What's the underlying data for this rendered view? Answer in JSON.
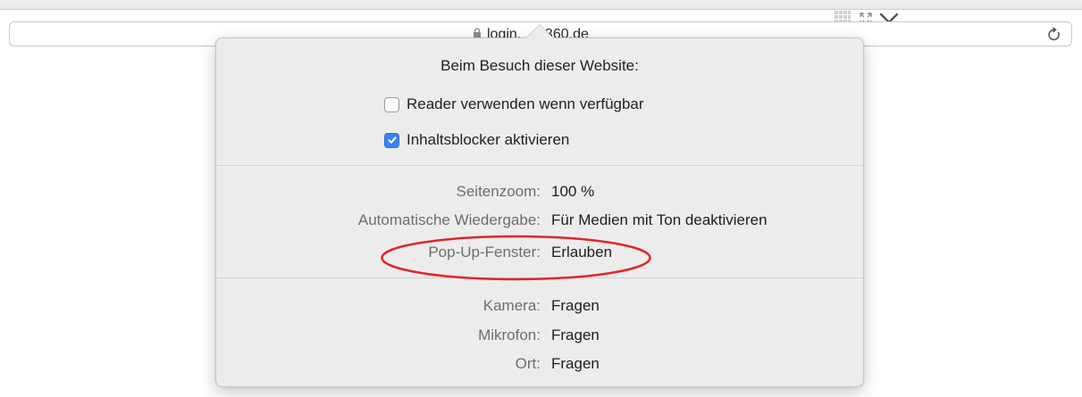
{
  "browser": {
    "url": "login.    a360.de",
    "reload_icon": "reload-icon",
    "lock_icon": "lock-icon"
  },
  "popover": {
    "heading": "Beim Besuch dieser Website:",
    "options": [
      {
        "label": "Reader verwenden wenn verfügbar",
        "checked": false
      },
      {
        "label": "Inhaltsblocker aktivieren",
        "checked": true
      }
    ],
    "settings_group1": [
      {
        "label": "Seitenzoom:",
        "value": "100 %"
      },
      {
        "label": "Automatische Wiedergabe:",
        "value": "Für Medien mit Ton deaktivieren"
      },
      {
        "label": "Pop-Up-Fenster:",
        "value": "Erlauben"
      }
    ],
    "settings_group2": [
      {
        "label": "Kamera:",
        "value": "Fragen"
      },
      {
        "label": "Mikrofon:",
        "value": "Fragen"
      },
      {
        "label": "Ort:",
        "value": "Fragen"
      }
    ]
  },
  "annotation": {
    "highlight_color": "#e0262b"
  },
  "colors": {
    "checkbox_accent": "#3b82f6",
    "popover_bg": "#ececec"
  }
}
